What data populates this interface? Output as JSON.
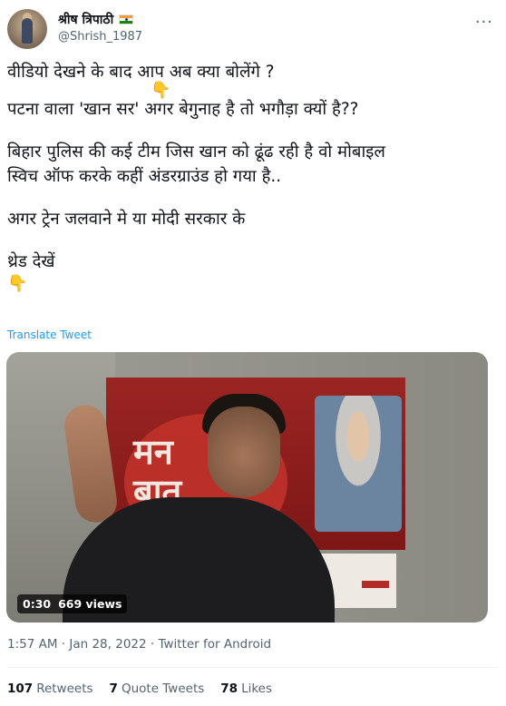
{
  "author": {
    "display_name": "श्रीष त्रिपाठी",
    "handle": "@Shrish_1987",
    "flag_icon": "india-flag-icon"
  },
  "more_icon": "···",
  "tweet": {
    "lines": [
      "वीडियो देखने के बाद आप अब क्या बोलेंगे ?",
      "पटना वाला 'खान सर' अगर बेगुनाह है तो भगौड़ा क्यों है??",
      "बिहार पुलिस की कई टीम जिस खान को ढूंढ रही है वो मोबाइल",
      "स्विच ऑफ करके कहीं अंडरग्राउंड हो गया है..",
      "अगर ट्रेन जलवाने मे या मोदी सरकार के",
      "थ्रेड देखें"
    ],
    "pointing_emoji": "👇",
    "translate_label": "Translate Tweet"
  },
  "media": {
    "duration": "0:30",
    "views": "669 views",
    "banner_text_1": "मन",
    "banner_text_2": "बात"
  },
  "meta": {
    "timestamp": "1:57 AM · Jan 28, 2022 · Twitter for Android"
  },
  "stats": {
    "retweets_count": "107",
    "retweets_label": "Retweets",
    "quotes_count": "7",
    "quotes_label": "Quote Tweets",
    "likes_count": "78",
    "likes_label": "Likes"
  },
  "colors": {
    "link": "#1d9bf0",
    "secondary_text": "#536471"
  }
}
